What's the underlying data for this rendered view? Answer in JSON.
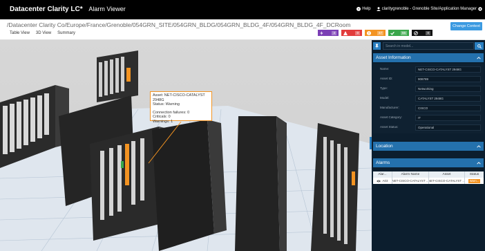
{
  "app": {
    "title": "Datacenter Clarity LC*",
    "subtitle": "Alarm Viewer",
    "help_label": "Help",
    "user_label": "claritygrenoble - Grenoble Site/Application Manager"
  },
  "breadcrumb": {
    "path": "/Datacenter Clarity Co/Europe/France/Grenoble/054GRN_SITE/054GRN_BLDG/054GRN_BLDG_4F/054GRN_BLDG_4F_DCRoom"
  },
  "views": [
    {
      "label": "Table View"
    },
    {
      "label": "3D View"
    },
    {
      "label": "Summary"
    }
  ],
  "counters": [
    {
      "icon": "lightning-icon",
      "value": "3",
      "color": "#7b3fb5"
    },
    {
      "icon": "critical-icon",
      "value": "0",
      "color": "#e23c3c"
    },
    {
      "icon": "warning-icon",
      "value": "47",
      "color": "#f39321"
    },
    {
      "icon": "check-icon",
      "value": "55",
      "color": "#3aa64a"
    },
    {
      "icon": "block-icon",
      "value": "0",
      "color": "#111111"
    }
  ],
  "change_context_label": "Change Context",
  "tooltip": {
    "asset": "Asset: NET-CISCO-CATALYST 2948G",
    "status": "Status: Warning",
    "connection_failures": "Connection failures: 0",
    "criticals": "Criticals: 0",
    "warnings": "Warnings: 1"
  },
  "panel": {
    "search_placeholder": "Search in model...",
    "asset_information_title": "Asset Information",
    "fields": [
      {
        "label": "Name:",
        "value": "NET-CISCO-CATALYST 2948G"
      },
      {
        "label": "Asset ID:",
        "value": "908789"
      },
      {
        "label": "Type:",
        "value": "Networking"
      },
      {
        "label": "Model:",
        "value": "CATALYST 2948G"
      },
      {
        "label": "Manufacturer:",
        "value": "CISCO"
      },
      {
        "label": "Asset Category:",
        "value": "IT"
      },
      {
        "label": "Asset Status:",
        "value": "Operational"
      }
    ],
    "location_title": "Location",
    "alarms_title": "Alarms",
    "alarm_columns": [
      "Alar...",
      "Alarm Name",
      "Asset",
      "Status"
    ],
    "alarm_rows": [
      {
        "id": "A03",
        "name": "NET-CISCO-CATALYST ...",
        "asset": "NET-CISCO-CATALYST ...",
        "status": "Warn..."
      }
    ]
  },
  "colors": {
    "accent": "#2471ad",
    "warning": "#f39321",
    "panel_bg": "#0c1e2e"
  }
}
